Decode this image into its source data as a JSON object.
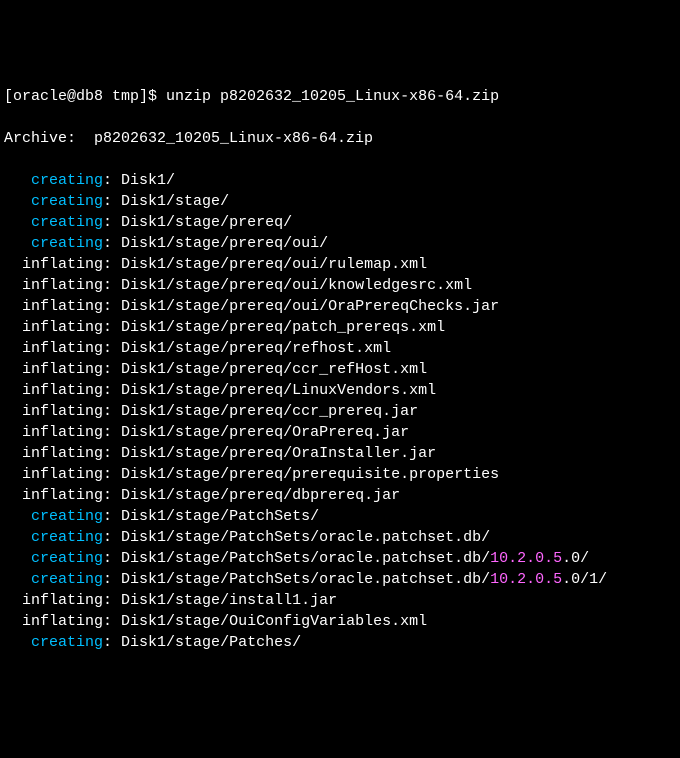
{
  "prompt": "[oracle@db8 tmp]$ ",
  "command": "unzip p8202632_10205_Linux-x86-64.zip",
  "archive_label": "Archive:  ",
  "archive_file": "p8202632_10205_Linux-x86-64.zip",
  "lines": [
    {
      "action": "creating",
      "path": "Disk1/"
    },
    {
      "action": "creating",
      "path": "Disk1/stage/"
    },
    {
      "action": "creating",
      "path": "Disk1/stage/prereq/"
    },
    {
      "action": "creating",
      "path": "Disk1/stage/prereq/oui/"
    },
    {
      "action": "inflating",
      "path": "Disk1/stage/prereq/oui/rulemap.xml"
    },
    {
      "action": "inflating",
      "path": "Disk1/stage/prereq/oui/knowledgesrc.xml"
    },
    {
      "action": "inflating",
      "path": "Disk1/stage/prereq/oui/OraPrereqChecks.jar"
    },
    {
      "action": "inflating",
      "path": "Disk1/stage/prereq/patch_prereqs.xml"
    },
    {
      "action": "inflating",
      "path": "Disk1/stage/prereq/refhost.xml"
    },
    {
      "action": "inflating",
      "path": "Disk1/stage/prereq/ccr_refHost.xml"
    },
    {
      "action": "inflating",
      "path": "Disk1/stage/prereq/LinuxVendors.xml"
    },
    {
      "action": "inflating",
      "path": "Disk1/stage/prereq/ccr_prereq.jar"
    },
    {
      "action": "inflating",
      "path": "Disk1/stage/prereq/OraPrereq.jar"
    },
    {
      "action": "inflating",
      "path": "Disk1/stage/prereq/OraInstaller.jar"
    },
    {
      "action": "inflating",
      "path": "Disk1/stage/prereq/prerequisite.properties"
    },
    {
      "action": "inflating",
      "path": "Disk1/stage/prereq/dbprereq.jar"
    },
    {
      "action": "creating",
      "path": "Disk1/stage/PatchSets/"
    },
    {
      "action": "creating",
      "path": "Disk1/stage/PatchSets/oracle.patchset.db/"
    },
    {
      "action": "creating",
      "path_pre": "Disk1/stage/PatchSets/oracle.patchset.db/",
      "version": "10.2.0.5",
      "path_post": ".0/"
    },
    {
      "action": "creating",
      "path_pre": "Disk1/stage/PatchSets/oracle.patchset.db/",
      "version": "10.2.0.5",
      "path_post": ".0/1/"
    },
    {
      "action": "inflating",
      "path": "Disk1/stage/install1.jar"
    },
    {
      "action": "inflating",
      "path": "Disk1/stage/OuiConfigVariables.xml"
    },
    {
      "action": "creating",
      "path": "Disk1/stage/Patches/"
    }
  ]
}
